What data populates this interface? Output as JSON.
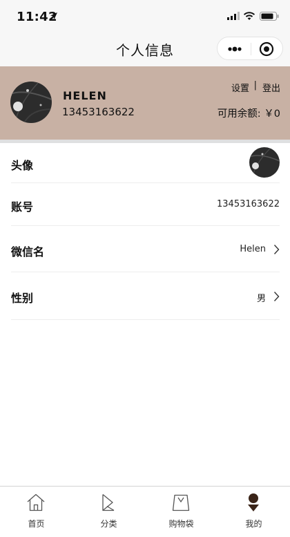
{
  "status_bar": {
    "time": "11:42"
  },
  "nav": {
    "title": "个人信息"
  },
  "profile": {
    "name": "HELEN",
    "phone": "13453163622",
    "settings_label": "设置",
    "separator": "|",
    "logout_label": "登出",
    "balance_label": "可用余额: ￥0"
  },
  "rows": [
    {
      "label": "头像"
    },
    {
      "label": "账号",
      "value": "13453163622"
    },
    {
      "label": "微信名",
      "value": "Helen"
    },
    {
      "label": "性别",
      "value": "男"
    }
  ],
  "tabs": [
    {
      "label": "首页",
      "icon": "home-icon"
    },
    {
      "label": "分类",
      "icon": "category-icon"
    },
    {
      "label": "购物袋",
      "icon": "shopping-bag-icon"
    },
    {
      "label": "我的",
      "icon": "profile-icon",
      "active": true
    }
  ],
  "colors": {
    "header_bg": "#c8b1a4",
    "accent": "#3a2418"
  }
}
